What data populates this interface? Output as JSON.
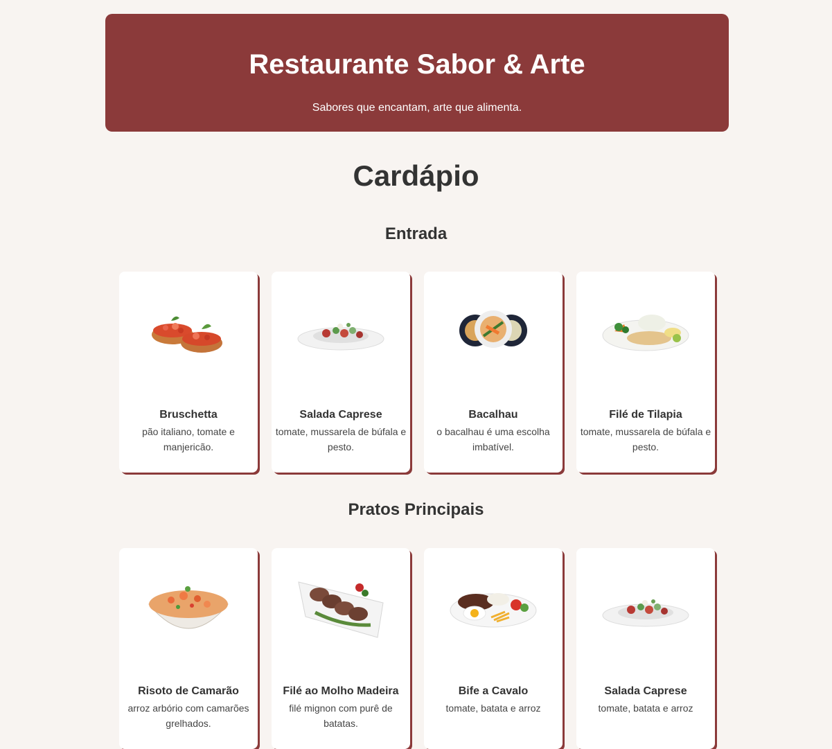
{
  "header": {
    "title": "Restaurante Sabor & Arte",
    "subtitle": "Sabores que encantam, arte que alimenta."
  },
  "menu_title": "Cardápio",
  "sections": [
    {
      "title": "Entrada",
      "items": [
        {
          "name": "Bruschetta",
          "description": "pão italiano, tomate e manjericão.",
          "image": "bruschetta-image"
        },
        {
          "name": "Salada Caprese",
          "description": "tomate, mussarela de búfala e pesto.",
          "image": "salad-plate-image"
        },
        {
          "name": "Bacalhau",
          "description": "o bacalhau é uma escolha imbatível.",
          "image": "bacalhau-plates-image"
        },
        {
          "name": "Filé de Tilapia",
          "description": "tomate, mussarela de búfala e pesto.",
          "image": "fish-plate-image"
        }
      ]
    },
    {
      "title": "Pratos Principais",
      "items": [
        {
          "name": "Risoto de Camarão",
          "description": "arroz arbório com camarões grelhados.",
          "image": "shrimp-risotto-image"
        },
        {
          "name": "Filé ao Molho Madeira",
          "description": "filé mignon com purê de batatas.",
          "image": "steak-slices-image"
        },
        {
          "name": "Bife a Cavalo",
          "description": "tomate, batata e arroz",
          "image": "steak-egg-plate-image"
        },
        {
          "name": "Salada Caprese",
          "description": "tomate, batata e arroz",
          "image": "salad-plate-image"
        }
      ]
    }
  ],
  "colors": {
    "accent": "#8b3a3a",
    "background": "#f8f4f1",
    "card": "#ffffff"
  }
}
